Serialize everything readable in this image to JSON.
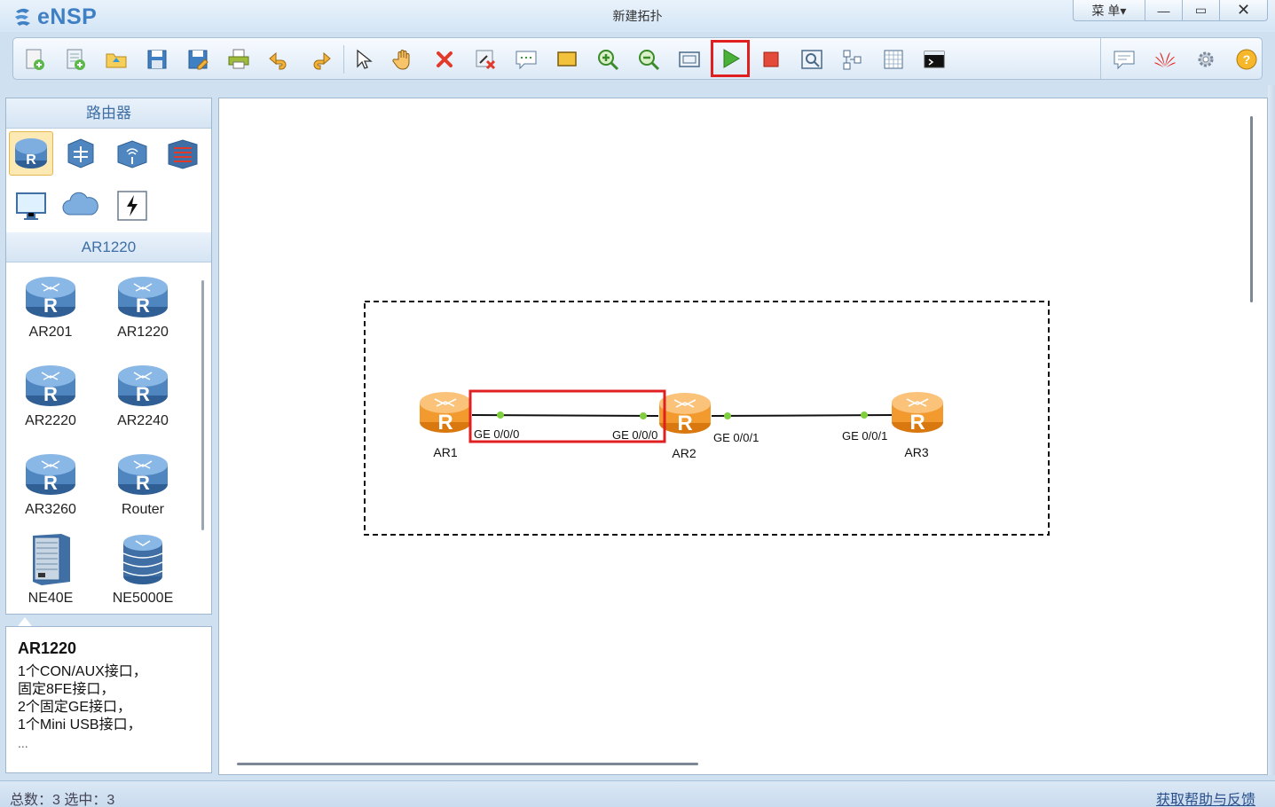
{
  "app": {
    "logo_text": "eNSP",
    "window_title": "新建拓扑",
    "menu_label": "菜 单▾",
    "minimize": "—",
    "maximize": "▭",
    "close": "✕"
  },
  "toolbar": {
    "buttons": [
      {
        "name": "new-topology-icon"
      },
      {
        "name": "new-template-icon"
      },
      {
        "name": "open-icon"
      },
      {
        "name": "save-icon"
      },
      {
        "name": "save-as-icon"
      },
      {
        "name": "print-icon"
      },
      {
        "name": "undo-icon"
      },
      {
        "name": "redo-icon"
      },
      {
        "name": "select-pointer-icon"
      },
      {
        "name": "pan-hand-icon"
      },
      {
        "name": "delete-icon"
      },
      {
        "name": "delete-link-icon"
      },
      {
        "name": "text-annotation-icon"
      },
      {
        "name": "rectangle-icon"
      },
      {
        "name": "zoom-in-icon"
      },
      {
        "name": "zoom-out-icon"
      },
      {
        "name": "fit-view-icon"
      },
      {
        "name": "start-device-icon",
        "highlighted": true
      },
      {
        "name": "stop-device-icon"
      },
      {
        "name": "capture-icon"
      },
      {
        "name": "topology-icon"
      },
      {
        "name": "grid-icon"
      },
      {
        "name": "console-icon"
      }
    ],
    "right_buttons": [
      {
        "name": "chat-icon"
      },
      {
        "name": "huawei-icon"
      },
      {
        "name": "settings-gear-icon"
      },
      {
        "name": "help-icon"
      }
    ]
  },
  "left_panel": {
    "category_header": "路由器",
    "device_header": "AR1220",
    "devices": [
      {
        "label": "AR201"
      },
      {
        "label": "AR1220"
      },
      {
        "label": "AR2220"
      },
      {
        "label": "AR2240"
      },
      {
        "label": "AR3260"
      },
      {
        "label": "Router"
      },
      {
        "label": "NE40E"
      },
      {
        "label": "NE5000E"
      }
    ]
  },
  "description": {
    "title": "AR1220",
    "lines": [
      "1个CON/AUX接口，",
      "固定8FE接口，",
      "2个固定GE接口，",
      "1个Mini USB接口，"
    ],
    "more": "..."
  },
  "topology": {
    "routers": [
      {
        "label": "AR1"
      },
      {
        "label": "AR2"
      },
      {
        "label": "AR3"
      }
    ],
    "links": [
      {
        "from": "AR1",
        "to": "AR2",
        "from_port": "GE 0/0/0",
        "to_port": "GE 0/0/0",
        "highlighted": true
      },
      {
        "from": "AR2",
        "to": "AR3",
        "from_port": "GE 0/0/1",
        "to_port": "GE 0/0/1",
        "highlighted": false
      }
    ]
  },
  "status": {
    "counts": "总数：3 选中：3",
    "help_link": "获取帮助与反馈"
  },
  "colors": {
    "accent": "#3f7fc4",
    "highlight": "#e02020",
    "router_orange": "#f39a2e",
    "router_blue": "#3f6fa4",
    "port_dot": "#7fcf3f"
  }
}
